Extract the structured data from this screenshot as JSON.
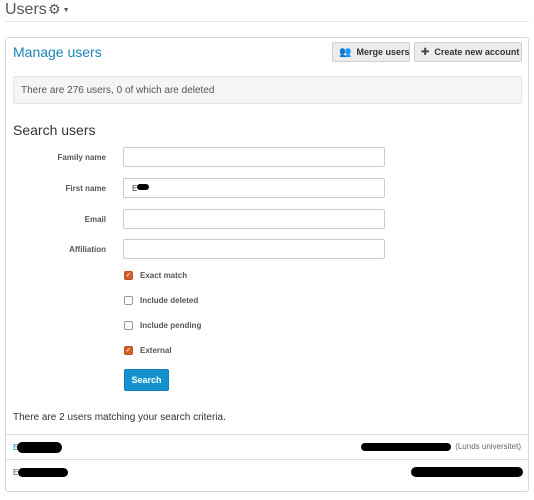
{
  "page": {
    "title": "Users"
  },
  "panel": {
    "title": "Manage users",
    "merge_label": "Merge users",
    "create_label": "Create new account",
    "summary": "There are 276 users, 0 of which are deleted"
  },
  "search": {
    "title": "Search users",
    "fields": [
      {
        "label": "Family name",
        "value": ""
      },
      {
        "label": "First name",
        "value": "E"
      },
      {
        "label": "Email",
        "value": ""
      },
      {
        "label": "Affiliation",
        "value": ""
      }
    ],
    "options": [
      {
        "label": "Exact match",
        "checked": true
      },
      {
        "label": "Include deleted",
        "checked": false
      },
      {
        "label": "Include pending",
        "checked": false
      },
      {
        "label": "External",
        "checked": true
      }
    ],
    "button_label": "Search"
  },
  "results": {
    "summary": "There are 2 users matching your search criteria.",
    "rows": [
      {
        "initial": "E",
        "affiliation": "(Lunds universitet)"
      },
      {
        "initial": "E",
        "affiliation": ""
      }
    ]
  },
  "colors": {
    "accent": "#1a84b8",
    "button_primary": "#1392cf",
    "checkbox_checked": "#d35d2b"
  }
}
